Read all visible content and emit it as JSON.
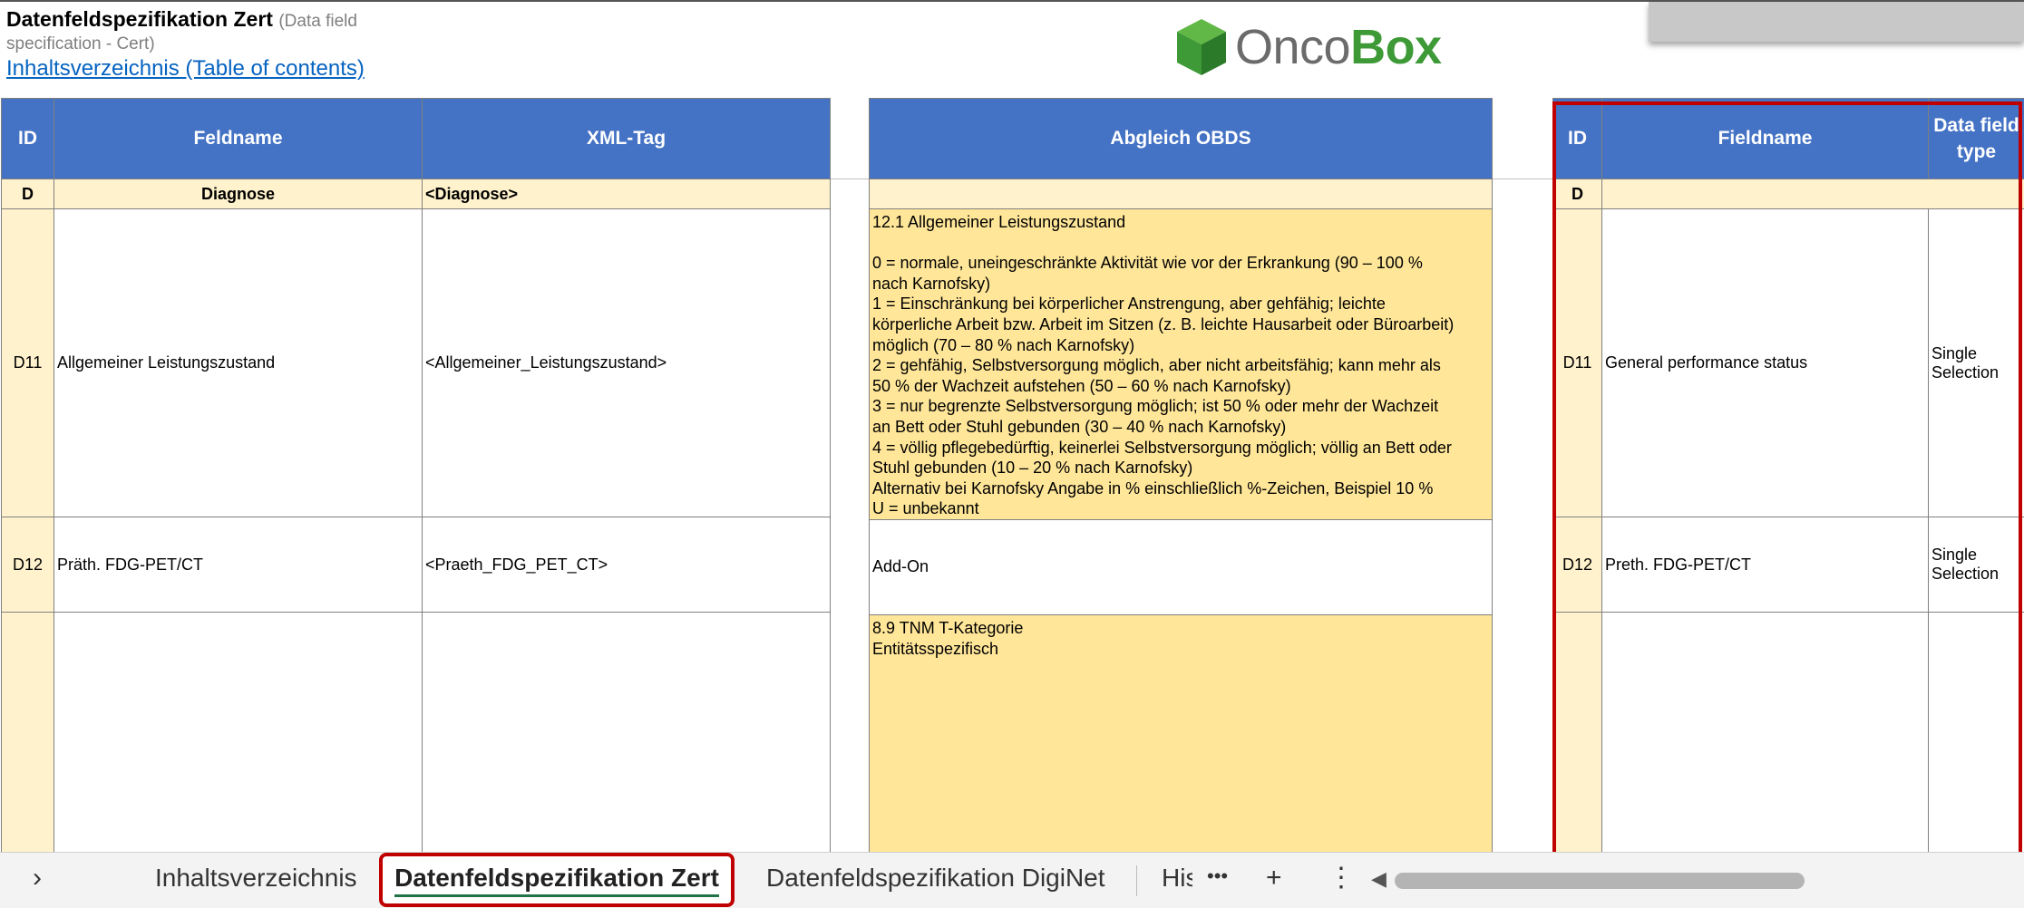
{
  "header": {
    "title": "Datenfeldspezifikation Zert",
    "subtitle_line1": "(Data field",
    "subtitle_line2": "specification - Cert)",
    "toc_link": "Inhaltsverzeichnis (Table of contents)"
  },
  "logo": {
    "part1": "Onco",
    "part2": "Box",
    "accent_color": "#3d9a37"
  },
  "table_de": {
    "headers": [
      "ID",
      "Feldname",
      "XML-Tag"
    ],
    "group": {
      "id": "D",
      "name": "Diagnose",
      "xml": "<Diagnose>"
    },
    "rows": [
      {
        "id": "D11",
        "name": "Allgemeiner Leistungszustand",
        "xml": "<Allgemeiner_Leistungszustand>"
      },
      {
        "id": "D12",
        "name": "Präth. FDG-PET/CT",
        "xml": "<Praeth_FDG_PET_CT>"
      },
      {
        "id": "",
        "name": "",
        "xml": ""
      }
    ]
  },
  "table_obds": {
    "header": "Abgleich OBDS",
    "rows": [
      "12.1 Allgemeiner Leistungszustand\n\n0 = normale, uneingeschränkte Aktivität wie vor der Erkrankung (90 – 100 %\nnach Karnofsky)\n1 = Einschränkung bei körperlicher Anstrengung, aber gehfähig; leichte\nkörperliche Arbeit bzw. Arbeit im Sitzen (z. B. leichte Hausarbeit oder Büroarbeit)\nmöglich (70 – 80 % nach Karnofsky)\n2 = gehfähig, Selbstversorgung möglich, aber nicht arbeitsfähig; kann mehr als\n50 % der Wachzeit aufstehen (50 – 60 % nach Karnofsky)\n3 = nur begrenzte Selbstversorgung möglich; ist 50 % oder mehr der Wachzeit\nan Bett oder Stuhl gebunden (30 – 40 % nach Karnofsky)\n4 = völlig pflegebedürftig, keinerlei Selbstversorgung möglich; völlig an Bett oder\nStuhl gebunden (10 – 20 % nach Karnofsky)\nAlternativ bei Karnofsky Angabe in % einschließlich %-Zeichen, Beispiel 10 %\nU = unbekannt",
      "Add-On",
      "8.9 TNM T-Kategorie\nEntitätsspezifisch"
    ]
  },
  "table_en": {
    "headers": [
      "ID",
      "Fieldname",
      "Data field type"
    ],
    "group": {
      "id": "D"
    },
    "rows": [
      {
        "id": "D11",
        "name": "General performance status",
        "type": "Single Selection"
      },
      {
        "id": "D12",
        "name": "Preth. FDG-PET/CT",
        "type": "Single Selection"
      },
      {
        "id": "",
        "name": "",
        "type": ""
      }
    ]
  },
  "sheet_tabs": {
    "items": [
      "Inhaltsverzeichnis",
      "Datenfeldspezifikation Zert",
      "Datenfeldspezifikation DigiNet",
      "His"
    ],
    "active_index": 1,
    "nav_prev": "›",
    "more": "•••",
    "add": "+",
    "options": "⋮",
    "scroll_left": "◀"
  },
  "colors": {
    "header_blue": "#4472c4",
    "light_yellow": "#fff2cc",
    "yellow": "#ffe699",
    "highlight_red": "#c00000"
  }
}
